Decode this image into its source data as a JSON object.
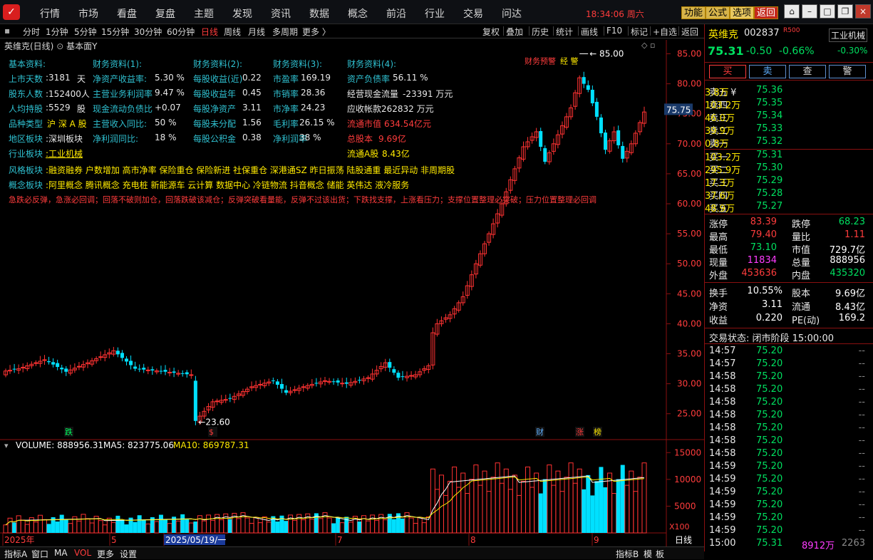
{
  "menu": {
    "items": [
      "行情",
      "市场",
      "看盘",
      "复盘",
      "主题",
      "发现",
      "资讯",
      "数据",
      "概念",
      "前沿",
      "行业",
      "交易",
      "问达"
    ],
    "clock": "18:34:06 周六",
    "buttons": [
      "功能",
      "公式",
      "选项",
      "返回"
    ]
  },
  "toolbar": {
    "periods": [
      "分时",
      "1分钟",
      "5分钟",
      "15分钟",
      "30分钟",
      "60分钟",
      "日线",
      "周线",
      "月线",
      "多周期",
      "更多 〉"
    ],
    "tools": [
      "复权",
      "叠加",
      "历史",
      "统计",
      "画线",
      "F10",
      "标记",
      "+自选",
      "返回"
    ]
  },
  "chart": {
    "title": "英维克(日线)",
    "subtitle": "基本面Y",
    "last_price_tag": "75.75",
    "high_label": "85.00",
    "low_label": "23.60",
    "warning_label": "财务预警",
    "warning_tag": "经 警",
    "y_ticks": [
      "85.00",
      "80.00",
      "75.00",
      "70.00",
      "65.00",
      "60.00",
      "55.00",
      "50.00",
      "45.00",
      "40.00",
      "35.00",
      "30.00",
      "25.00"
    ],
    "markers": {
      "die": "跌",
      "s": "$",
      "cai": "财",
      "zhang": "涨",
      "bang": "榜"
    },
    "volume_header": {
      "name": "VOLUME: 888956.31",
      "ma5": "MA5: 823775.06",
      "ma10": "MA10: 869787.31"
    },
    "volume_ticks": [
      "15000",
      "10000",
      "5000"
    ],
    "volume_unit": "X100",
    "x_labels": [
      "2025年",
      "5",
      "2025/05/19/一",
      "7",
      "8",
      "9"
    ],
    "x_right": "日线"
  },
  "fundamentals": {
    "headers": [
      "基本资料:",
      "财务资料(1):",
      "财务资料(2):",
      "财务资料(3):",
      "财务资料(4):"
    ],
    "col1": [
      [
        "上市天数",
        ":3181",
        "天"
      ],
      [
        "股东人数",
        ":152400人",
        ""
      ],
      [
        "人均持股",
        ":5529",
        "股"
      ],
      [
        "品种类型",
        "沪 深 A 股",
        ""
      ],
      [
        "地区板块",
        ":深圳板块",
        ""
      ],
      [
        "行业板块",
        ":工业机械",
        ""
      ]
    ],
    "col2": [
      [
        "净资产收益率:",
        "5.30 %"
      ],
      [
        "主营业务利润率",
        "9.47 %"
      ],
      [
        "现金流动负债比",
        "+0.07"
      ],
      [
        "主营收入同比:",
        "50 %"
      ],
      [
        "净利润同比:",
        "18 %"
      ]
    ],
    "col3": [
      [
        "每股收益(近)",
        "0.22"
      ],
      [
        "每股收益年",
        "0.45"
      ],
      [
        "每股净资产",
        "3.11"
      ],
      [
        "每股未分配",
        "1.56"
      ],
      [
        "每股公积金",
        "0.38"
      ]
    ],
    "col4": [
      [
        "市盈率",
        "169.19"
      ],
      [
        "市销率",
        "28.36"
      ],
      [
        "市净率",
        "24.23"
      ],
      [
        "毛利率",
        "26.15 %"
      ],
      [
        "净利润率",
        "38 %"
      ]
    ],
    "col5": [
      [
        "资产负债率",
        "56.11 %"
      ],
      [
        "经营现金流量",
        "-23391 万元"
      ],
      [
        "应收帐款",
        "262832 万元"
      ],
      [
        "流通市值",
        "634.54亿元"
      ],
      [
        "总股本",
        "9.69亿"
      ],
      [
        "流通A股",
        "8.43亿"
      ]
    ],
    "style_label": "风格板块",
    "style_value": ":融资融券 户数增加 高市净率 保险重仓 保险新进 社保重仓 深港通SZ 昨日振荡 陆股通重 最近异动 非周期股",
    "concept_label": "概念板块",
    "concept_value": ":阿里概念 腾讯概念 充电桩 新能源车 云计算 数据中心 冷链物流 抖音概念 储能 英伟达 液冷服务",
    "slogan": "急跌必反弹，急涨必回调；回落不破则加仓，回落跌破该减仓；反弹突破看量能，反弹不过该出货；下跌找支撑，上涨看压力；支撑位置整理必突破；压力位置整理必回调"
  },
  "stock": {
    "name": "英维克",
    "code": "002837",
    "tag": "R500",
    "industry": "工业机械",
    "price": "75.31",
    "change": "-0.50",
    "pct": "-0.66%",
    "ind_pct": "-0.30%",
    "actions": [
      "买",
      "卖",
      "查",
      "警"
    ],
    "sell": [
      [
        "卖五 ¥",
        "75.36",
        "3.8万"
      ],
      [
        "卖四",
        "75.35",
        "103.2万"
      ],
      [
        "卖三",
        "75.34",
        "46.0万"
      ],
      [
        "卖二",
        "75.33",
        "39.9万"
      ],
      [
        "卖一",
        "75.32",
        "0.8万"
      ]
    ],
    "buy": [
      [
        "买一",
        "75.31",
        "103.2万"
      ],
      [
        "买二",
        "75.30",
        "295.9万"
      ],
      [
        "买三",
        "75.29",
        "17.3万"
      ],
      [
        "买四",
        "75.28",
        "37.6万"
      ],
      [
        "买五",
        "75.27",
        "48.9万"
      ]
    ],
    "stats": [
      [
        "涨停",
        "83.39",
        "跌停",
        "68.23"
      ],
      [
        "最高",
        "79.40",
        "量比",
        "1.11"
      ],
      [
        "最低",
        "73.10",
        "市值",
        "729.7亿"
      ],
      [
        "现量",
        "11834",
        "总量",
        "888956"
      ],
      [
        "外盘",
        "453636",
        "内盘",
        "435320"
      ]
    ],
    "stats2": [
      [
        "换手",
        "10.55%",
        "股本",
        "9.69亿"
      ],
      [
        "净资",
        "3.11",
        "流通",
        "8.43亿"
      ],
      [
        "收益",
        "0.220",
        "PE(动)",
        "169.2"
      ]
    ],
    "trade_state": "交易状态: 闭市阶段 15:00:00",
    "ticks": [
      [
        "14:57",
        "75.20",
        "--"
      ],
      [
        "14:57",
        "75.20",
        "--"
      ],
      [
        "14:58",
        "75.20",
        "--"
      ],
      [
        "14:58",
        "75.20",
        "--"
      ],
      [
        "14:58",
        "75.20",
        "--"
      ],
      [
        "14:58",
        "75.20",
        "--"
      ],
      [
        "14:58",
        "75.20",
        "--"
      ],
      [
        "14:58",
        "75.20",
        "--"
      ],
      [
        "14:58",
        "75.20",
        "--"
      ],
      [
        "14:59",
        "75.20",
        "--"
      ],
      [
        "14:59",
        "75.20",
        "--"
      ],
      [
        "14:59",
        "75.20",
        "--"
      ],
      [
        "14:59",
        "75.20",
        "--"
      ],
      [
        "14:59",
        "75.20",
        "--"
      ],
      [
        "14:59",
        "75.20",
        "--"
      ],
      [
        "15:00",
        "75.31",
        "8912万",
        "2263"
      ]
    ]
  },
  "bottom": {
    "left": [
      "指标A",
      "窗口",
      "MA",
      "VOL",
      "更多",
      "设置"
    ],
    "right": [
      "指标B",
      "模",
      "板"
    ]
  }
}
